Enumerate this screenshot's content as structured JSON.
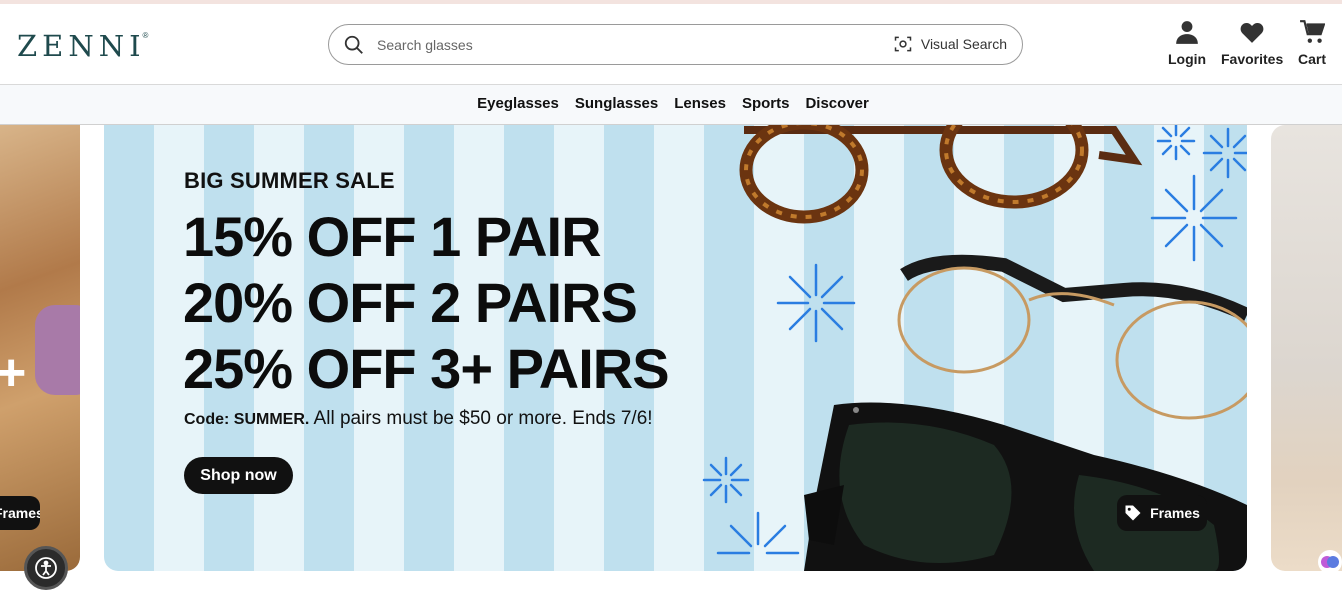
{
  "header": {
    "logo_text": "ZENNI",
    "logo_mark": "®",
    "search": {
      "placeholder": "Search glasses",
      "value": ""
    },
    "visual_search_label": "Visual Search",
    "login_label": "Login",
    "favorites_label": "Favorites",
    "cart_label": "Cart"
  },
  "nav": {
    "items": [
      {
        "label": "Eyeglasses"
      },
      {
        "label": "Sunglasses"
      },
      {
        "label": "Lenses"
      },
      {
        "label": "Sports"
      },
      {
        "label": "Discover"
      }
    ]
  },
  "carousel": {
    "prev_slide": {
      "pill_label": "Frames"
    },
    "hero": {
      "eyebrow": "BIG SUMMER SALE",
      "line1": "15% OFF 1 PAIR",
      "line2": "20% OFF 2 PAIRS",
      "line3": "25% OFF 3+ PAIRS",
      "code_prefix": "Code: SUMMER.",
      "code_rest": " All pairs must be $50 or more. Ends 7/6!",
      "cta_label": "Shop now",
      "frames_pill_label": "Frames"
    }
  },
  "colors": {
    "brand": "#1f4a4d",
    "stripe_dark": "#bfe0ee",
    "stripe_light": "#e7f4f9",
    "firework": "#2a7de1"
  }
}
